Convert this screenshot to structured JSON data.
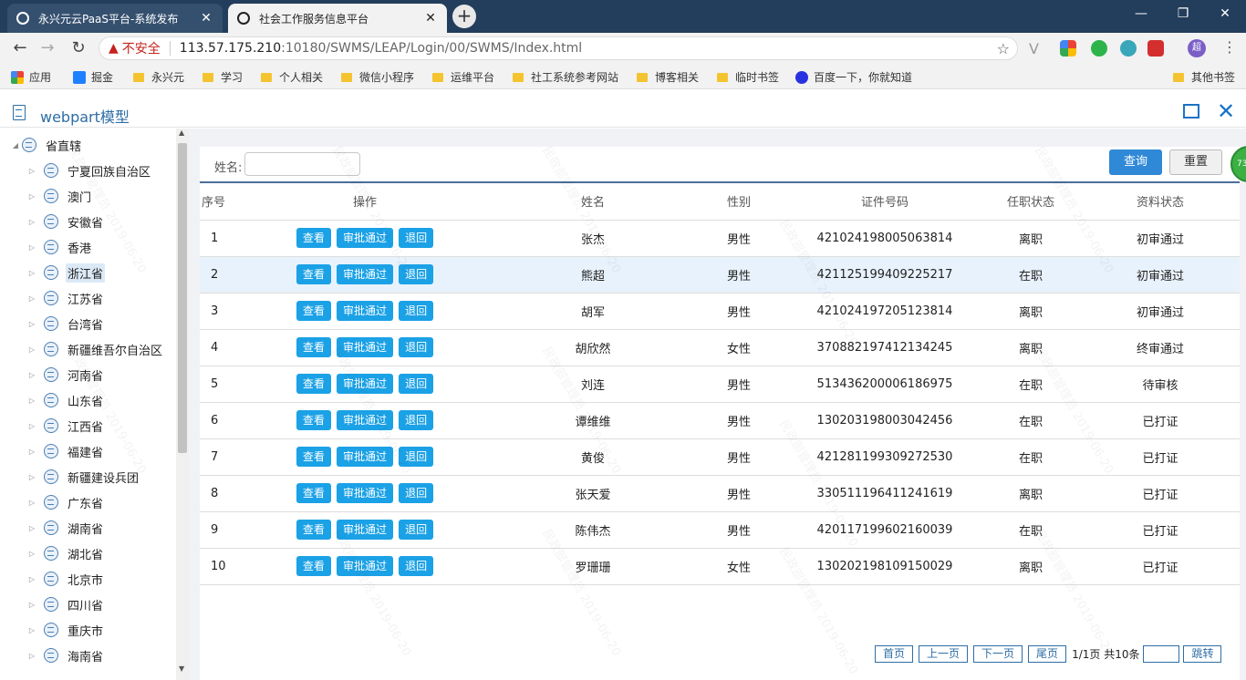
{
  "browser": {
    "tabs": [
      {
        "title": "永兴元云PaaS平台-系统发布",
        "active": false
      },
      {
        "title": "社会工作服务信息平台",
        "active": true
      }
    ],
    "new_tab_label": "+",
    "window_controls": [
      "—",
      "❐",
      "✕"
    ],
    "insecure_label": "不安全",
    "url_host": "113.57.175.210",
    "url_rest": ":10180/SWMS/LEAP/Login/00/SWMS/Index.html",
    "bookmarks": [
      "应用",
      "掘金",
      "永兴元",
      "学习",
      "个人相关",
      "微信小程序",
      "运维平台",
      "社工系统参考网站",
      "博客相关",
      "临时书签",
      "百度一下，你就知道"
    ],
    "other_bookmarks": "其他书签",
    "profile_initial": "超"
  },
  "app": {
    "title": "webpart模型"
  },
  "tree": {
    "root": "省直辖",
    "items": [
      "宁夏回族自治区",
      "澳门",
      "安徽省",
      "香港",
      "浙江省",
      "江苏省",
      "台湾省",
      "新疆维吾尔自治区",
      "河南省",
      "山东省",
      "江西省",
      "福建省",
      "新疆建设兵团",
      "广东省",
      "湖南省",
      "湖北省",
      "北京市",
      "四川省",
      "重庆市",
      "海南省"
    ],
    "selected": "浙江省"
  },
  "search": {
    "name_label": "姓名:",
    "name_value": "",
    "query_button": "查询",
    "reset_button": "重置"
  },
  "badge_text": "73",
  "table": {
    "headers": [
      "序号",
      "操作",
      "姓名",
      "性别",
      "证件号码",
      "任职状态",
      "资料状态"
    ],
    "action_labels": {
      "view": "查看",
      "approve": "审批通过",
      "reject": "退回"
    },
    "rows": [
      {
        "no": "1",
        "name": "张杰",
        "gender": "男性",
        "id": "421024198005063814",
        "job": "离职",
        "status": "初审通过"
      },
      {
        "no": "2",
        "name": "熊超",
        "gender": "男性",
        "id": "421125199409225217",
        "job": "在职",
        "status": "初审通过"
      },
      {
        "no": "3",
        "name": "胡军",
        "gender": "男性",
        "id": "421024197205123814",
        "job": "离职",
        "status": "初审通过"
      },
      {
        "no": "4",
        "name": "胡欣然",
        "gender": "女性",
        "id": "370882197412134245",
        "job": "离职",
        "status": "终审通过"
      },
      {
        "no": "5",
        "name": "刘连",
        "gender": "男性",
        "id": "513436200006186975",
        "job": "在职",
        "status": "待审核"
      },
      {
        "no": "6",
        "name": "谭维维",
        "gender": "男性",
        "id": "130203198003042456",
        "job": "在职",
        "status": "已打证"
      },
      {
        "no": "7",
        "name": "黄俊",
        "gender": "男性",
        "id": "421281199309272530",
        "job": "在职",
        "status": "已打证"
      },
      {
        "no": "8",
        "name": "张天爱",
        "gender": "男性",
        "id": "330511196411241619",
        "job": "离职",
        "status": "已打证"
      },
      {
        "no": "9",
        "name": "陈伟杰",
        "gender": "男性",
        "id": "420117199602160039",
        "job": "在职",
        "status": "已打证"
      },
      {
        "no": "10",
        "name": "罗珊珊",
        "gender": "女性",
        "id": "130202198109150029",
        "job": "离职",
        "status": "已打证"
      }
    ],
    "highlighted_row": 2
  },
  "pager": {
    "first": "首页",
    "prev": "上一页",
    "next": "下一页",
    "last": "尾页",
    "info": "1/1页 共10条",
    "jump": "跳转"
  },
  "watermark": {
    "line1": "民政部管理员",
    "line2": "2019-06-20"
  },
  "colors": {
    "accent": "#2f89d6",
    "action": "#1ba1e6",
    "title": "#2e6ea6",
    "tabbar": "#233d5c"
  }
}
